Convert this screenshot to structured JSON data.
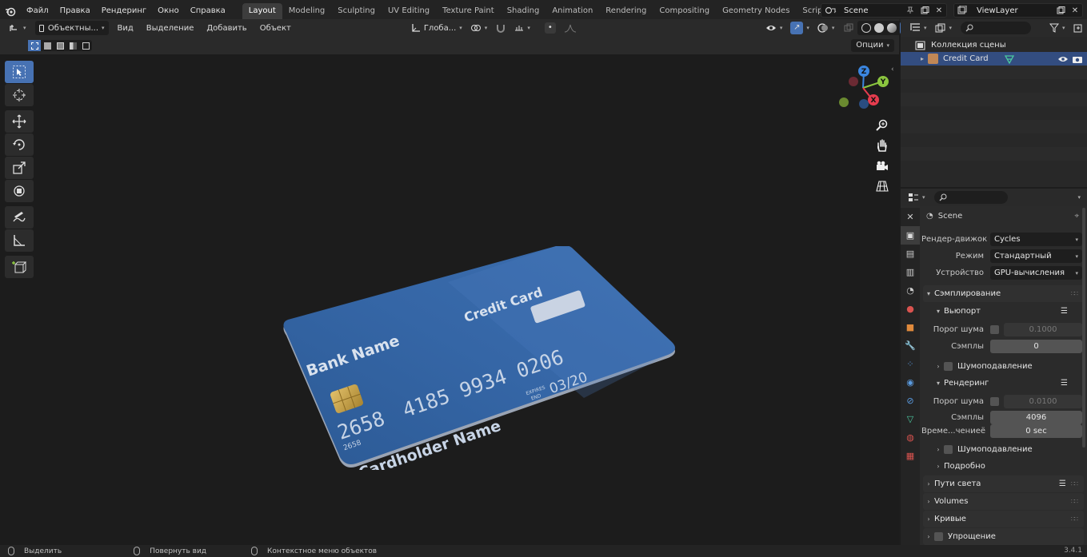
{
  "topbar": {
    "menus": [
      "Файл",
      "Правка",
      "Рендеринг",
      "Окно",
      "Справка"
    ],
    "workspaces": [
      "Layout",
      "Modeling",
      "Sculpting",
      "UV Editing",
      "Texture Paint",
      "Shading",
      "Animation",
      "Rendering",
      "Compositing",
      "Geometry Nodes",
      "Scripting"
    ],
    "active_workspace": "Layout",
    "scene": "Scene",
    "view_layer": "ViewLayer"
  },
  "viewport_header": {
    "mode": "Объектны...",
    "menus": [
      "Вид",
      "Выделение",
      "Добавить",
      "Объект"
    ],
    "orientation": "Глоба...",
    "options": "Опции"
  },
  "card": {
    "bank": "Bank Name",
    "title": "Credit Card",
    "number_main": "4185 9934 0206",
    "number_first": "2658",
    "number_small": "2658",
    "expires_label_1": "EXPIRES",
    "expires_label_2": "END",
    "expiry": "03/20",
    "holder": "Cardholder Name"
  },
  "outliner": {
    "collection": "Коллекция сцены",
    "object": "Credit Card"
  },
  "properties": {
    "context": "Scene",
    "render_engine_label": "Рендер-движок",
    "render_engine": "Cycles",
    "mode_label": "Режим",
    "mode": "Стандартный",
    "device_label": "Устройство",
    "device": "GPU-вычисления",
    "sampling": "Сэмплирование",
    "viewport": "Вьюпорт",
    "noise_threshold_label": "Порог шума",
    "vp_noise_threshold": "0.1000",
    "samples_label": "Сэмплы",
    "vp_samples": "0",
    "denoise": "Шумоподавление",
    "render": "Рендеринг",
    "r_noise_threshold": "0.0100",
    "r_samples": "4096",
    "time_limit_label": "Време...чениеё",
    "time_limit": "0 sec",
    "advanced": "Подробно",
    "light_paths": "Пути света",
    "volumes": "Volumes",
    "curves": "Кривые",
    "simplify": "Упрощение"
  },
  "statusbar": {
    "select": "Выделить",
    "rotate": "Повернуть вид",
    "context_menu": "Контекстное меню объектов",
    "version": "3.4.1"
  },
  "colors": {
    "accent": "#4772b3",
    "card_blue": "#2f5f9e",
    "axis_x": "#e53c4e",
    "axis_y": "#8bc53f",
    "axis_z": "#3b86e0"
  }
}
